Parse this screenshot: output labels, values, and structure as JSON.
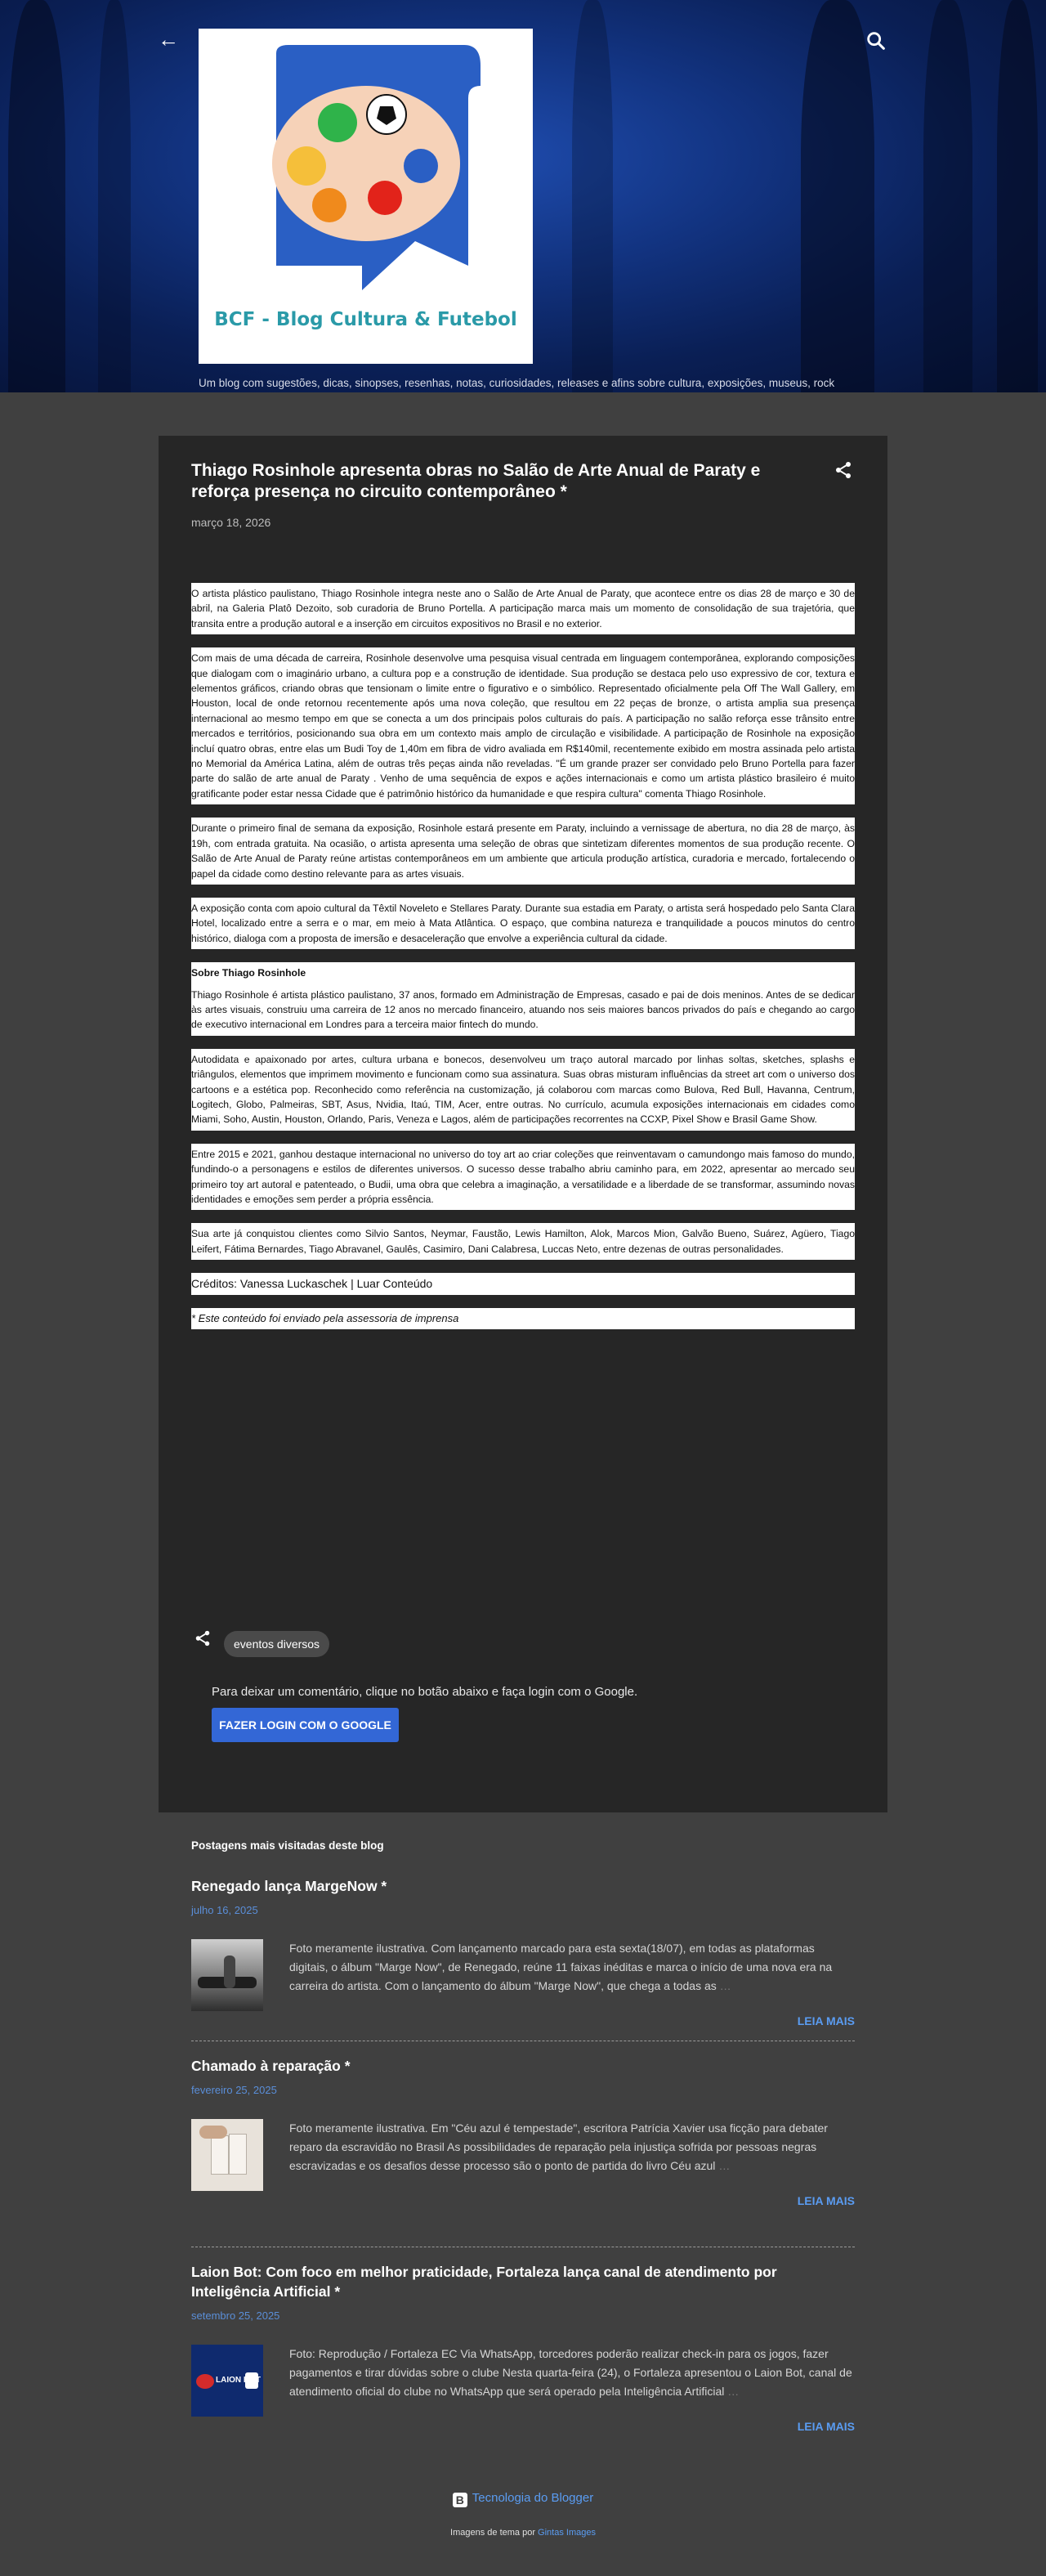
{
  "header": {
    "back_icon": "arrow-left-icon",
    "search_icon": "search-icon",
    "logo_text": "BCF - Blog Cultura & Futebol",
    "tagline": "Um blog com sugestões, dicas, sinopses, resenhas, notas, curiosidades, releases e afins sobre cultura, exposições, museus, rock and roll, música, futebol, etc."
  },
  "post": {
    "title": "Thiago Rosinhole apresenta obras no Salão de Arte Anual de Paraty e reforça presença no circuito contemporâneo *",
    "date": "março 18, 2026",
    "share_icon": "share-icon",
    "paragraphs": [
      "O artista plástico paulistano, Thiago Rosinhole integra neste ano o Salão de Arte Anual de Paraty, que acontece entre os dias 28 de março e 30 de abril, na Galeria Platô Dezoito, sob curadoria de Bruno Portella. A participação marca mais um momento de consolidação de sua trajetória, que transita entre a produção autoral e a inserção em circuitos expositivos no Brasil e no exterior.",
      "Com mais de uma década de carreira, Rosinhole desenvolve uma pesquisa visual centrada em linguagem contemporânea, explorando composições que dialogam com o imaginário urbano, a cultura pop e a construção de identidade. Sua produção se destaca pelo uso expressivo de cor, textura e elementos gráficos, criando obras que tensionam o limite entre o figurativo e o simbólico. Representado oficialmente pela Off The Wall Gallery, em Houston, local de onde retornou recentemente após uma nova coleção, que resultou em 22 peças de bronze, o artista amplia sua presença internacional ao mesmo tempo em que se conecta a um dos principais polos culturais do país. A participação no salão reforça esse trânsito entre mercados e territórios, posicionando sua obra em um contexto mais amplo de circulação e visibilidade. A participação de Rosinhole na exposição incluí quatro obras, entre elas um Budi Toy de 1,40m em fibra de vidro avaliada em  R$140mil, recentemente exibido em mostra assinada pelo artista no Memorial da América Latina, além de outras três peças ainda não reveladas.  \"É um grande prazer ser convidado pelo Bruno Portella para fazer parte do salão de arte anual de Paraty . Venho de uma sequência de expos e ações internacionais e como um artista plástico brasileiro é muito gratificante poder estar nessa Cidade que é patrimônio histórico da humanidade e que respira cultura\" comenta Thiago Rosinhole.",
      "Durante o primeiro final de semana da exposição, Rosinhole estará presente em Paraty, incluindo a vernissage de abertura, no dia 28 de março, às 19h, com entrada gratuita. Na ocasião, o artista apresenta uma seleção de obras que sintetizam diferentes momentos de sua produção recente. O Salão de Arte Anual de Paraty reúne artistas contemporâneos em um ambiente que articula produção artística, curadoria e mercado, fortalecendo o papel da cidade como destino relevante para as artes visuais.",
      "A exposição conta com apoio cultural da Têxtil Noveleto e Stellares Paraty. Durante sua estadia em Paraty, o artista será hospedado pelo Santa Clara Hotel, localizado entre a serra e o mar, em meio à Mata Atlântica. O espaço, que combina natureza e tranquilidade a poucos minutos do centro histórico, dialoga com a proposta de imersão e desaceleração que envolve a experiência cultural da cidade."
    ],
    "about_heading": "Sobre Thiago Rosinhole",
    "about_paragraphs": [
      "Thiago Rosinhole é artista plástico paulistano, 37 anos, formado em Administração de Empresas, casado e pai de dois meninos. Antes de se dedicar às artes visuais, construiu uma carreira de 12 anos no mercado financeiro, atuando nos seis maiores bancos privados do país e chegando ao cargo de executivo internacional em Londres para a terceira maior fintech do mundo.",
      "Autodidata e apaixonado por artes, cultura urbana e bonecos, desenvolveu um traço autoral marcado por linhas soltas, sketches, splashs e triângulos, elementos que imprimem movimento e funcionam como sua assinatura. Suas obras misturam influências da street art com o universo dos cartoons e a estética pop. Reconhecido como referência na customização, já colaborou com marcas como Bulova, Red Bull, Havanna, Centrum, Logitech, Globo, Palmeiras, SBT, Asus, Nvidia, Itaú, TIM, Acer, entre outras. No currículo, acumula exposições internacionais em cidades como Miami, Soho, Austin, Houston, Orlando, Paris, Veneza e Lagos, além de participações recorrentes na CCXP, Pixel Show e Brasil Game Show.",
      "Entre 2015 e 2021, ganhou destaque internacional no universo do toy art ao criar coleções que reinventavam o camundongo mais famoso do mundo, fundindo-o a personagens e estilos de diferentes universos. O sucesso desse trabalho abriu caminho para, em 2022, apresentar ao mercado seu primeiro toy art autoral e patenteado, o Budii, uma obra que celebra a imaginação, a versatilidade e a liberdade de se transformar, assumindo novas identidades e emoções sem perder a própria essência.",
      "Sua arte já conquistou clientes como Silvio Santos, Neymar, Faustão, Lewis Hamilton, Alok, Marcos Mion, Galvão Bueno, Suárez, Agüero, Tiago Leifert, Fátima Bernardes, Tiago Abravanel, Gaulês, Casimiro, Dani Calabresa, Luccas Neto, entre dezenas de outras personalidades."
    ],
    "credits": "Créditos: Vanessa Luckaschek | Luar Conteúdo",
    "note": "* Este conteúdo foi enviado pela assessoria de imprensa",
    "label": "eventos diversos",
    "comment_prompt": "Para deixar um comentário, clique no botão abaixo e faça login com o Google.",
    "login_button": "FAZER LOGIN COM O GOOGLE"
  },
  "popular": {
    "heading": "Postagens mais visitadas deste blog",
    "read_more": "LEIA MAIS",
    "items": [
      {
        "title": "Renegado lança MargeNow *",
        "date": "julho 16, 2025",
        "snippet": "Foto meramente ilustrativa. Com lançamento marcado para esta sexta(18/07), em todas as plataformas digitais, o álbum \"Marge Now\", de Renegado, reúne 11 faixas inéditas e marca o início de uma nova era na carreira do artista. Com o lançamento do álbum \"Marge Now\", que chega a todas as",
        "ellipsis": "…"
      },
      {
        "title": "Chamado à reparação *",
        "date": "fevereiro 25, 2025",
        "snippet": "Foto meramente ilustrativa. Em \"Céu azul é tempestade\", escritora Patrícia Xavier usa ficção para debater reparo da escravidão no Brasil As possibilidades de reparação pela injustiça sofrida por pessoas negras escravizadas e os desafios desse processo são o ponto de partida do livro  Céu azul",
        "ellipsis": "…"
      },
      {
        "title": "Laion Bot: Com foco em melhor praticidade, Fortaleza lança canal de atendimento por Inteligência Artificial *",
        "date": "setembro 25, 2025",
        "snippet": "Foto: Reprodução / Fortaleza EC Via WhatsApp, torcedores poderão realizar check-in para os jogos, fazer pagamentos e tirar dúvidas sobre o clube Nesta quarta-feira (24), o Fortaleza apresentou o Laion Bot, canal de atendimento oficial do clube no WhatsApp que será operado pela Inteligência Artificial",
        "ellipsis": "…",
        "thumb_text": "LAION BOT"
      }
    ]
  },
  "footer": {
    "powered_by": "Tecnologia do Blogger",
    "theme_credit_prefix": "Imagens de tema por",
    "theme_credit_link": "Gintas Images"
  },
  "colors": {
    "page_bg": "#404040",
    "card_bg": "#262626",
    "accent": "#3367d6",
    "link": "#5a9cf2"
  }
}
